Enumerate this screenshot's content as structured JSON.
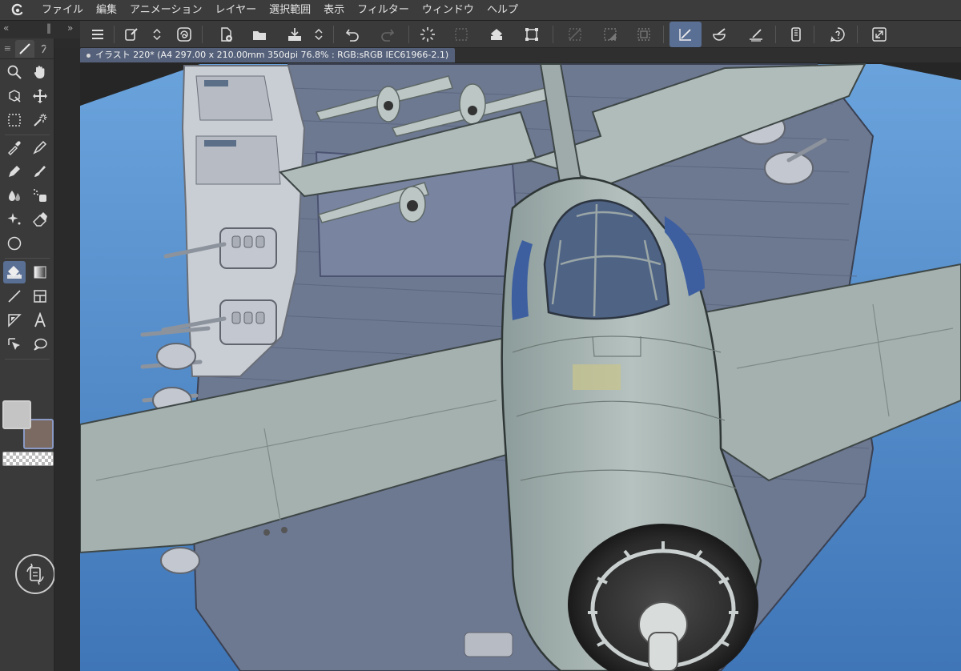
{
  "menu": {
    "items": [
      "ファイル",
      "編集",
      "アニメーション",
      "レイヤー",
      "選択範囲",
      "表示",
      "フィルター",
      "ウィンドウ",
      "ヘルプ"
    ]
  },
  "leftstrip": {
    "collapse_left": "«",
    "grip": "‖",
    "collapse_right": "»"
  },
  "document": {
    "tab_title": "イラスト 220* (A4 297.00 x 210.00mm 350dpi 76.8% : RGB:sRGB IEC61966-2.1)"
  },
  "colors": {
    "main_color": "#c4c4c4",
    "sub_color": "#7a6a62",
    "accent": "#5a6f94",
    "sky": "#4f86c8",
    "deck": "#6d7891",
    "plane": "#a8b5b2"
  },
  "tools": [
    "magnify-icon",
    "hand-icon",
    "operation-icon",
    "move-layer-icon",
    "selection-icon",
    "auto-select-icon",
    "eyedropper-icon",
    "pen-icon",
    "pencil-icon",
    "brush-icon",
    "blend-icon",
    "airbrush-icon",
    "decoration-icon",
    "eraser-icon",
    "figure-circle-icon",
    "fill-icon",
    "gradient-icon",
    "line-icon",
    "frame-border-icon",
    "ruler-icon",
    "text-icon",
    "object-select-icon",
    "balloon-icon"
  ],
  "commands": [
    "menu-icon",
    "new-icon",
    "stepper-icon",
    "companion-icon",
    "new-file-icon",
    "open-icon",
    "save-icon",
    "stepper-icon",
    "undo-icon",
    "redo-icon",
    "loading-icon",
    "clear-icon",
    "fill-icon",
    "transform-icon",
    "deselect-icon",
    "invert-icon",
    "border-icon",
    "snap-ruler-icon",
    "snap-guide-icon",
    "snap-grid-icon",
    "smartphone-icon",
    "help-icon",
    "fullscreen-icon"
  ]
}
